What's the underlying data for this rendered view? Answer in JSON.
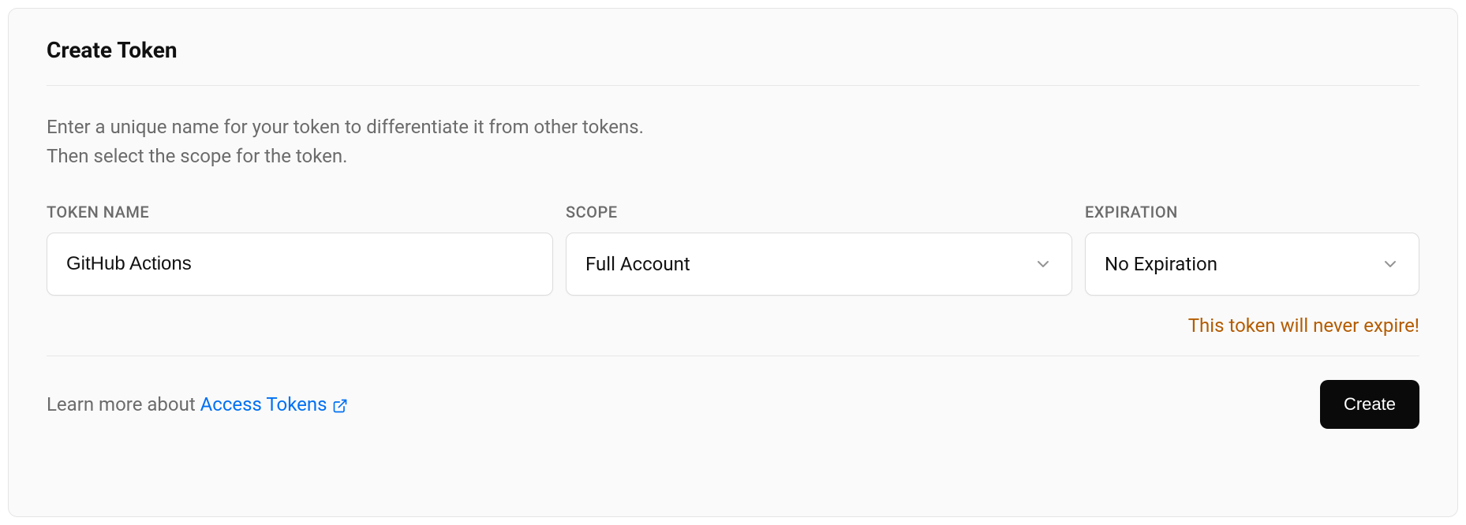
{
  "card": {
    "title": "Create Token",
    "description_line1": "Enter a unique name for your token to differentiate it from other tokens.",
    "description_line2": "Then select the scope for the token."
  },
  "fields": {
    "token_name": {
      "label": "TOKEN NAME",
      "value": "GitHub Actions"
    },
    "scope": {
      "label": "SCOPE",
      "value": "Full Account"
    },
    "expiration": {
      "label": "EXPIRATION",
      "value": "No Expiration"
    }
  },
  "warning": "This token will never expire!",
  "footer": {
    "learn_prefix": "Learn more about ",
    "link_text": "Access Tokens",
    "button_label": "Create"
  }
}
